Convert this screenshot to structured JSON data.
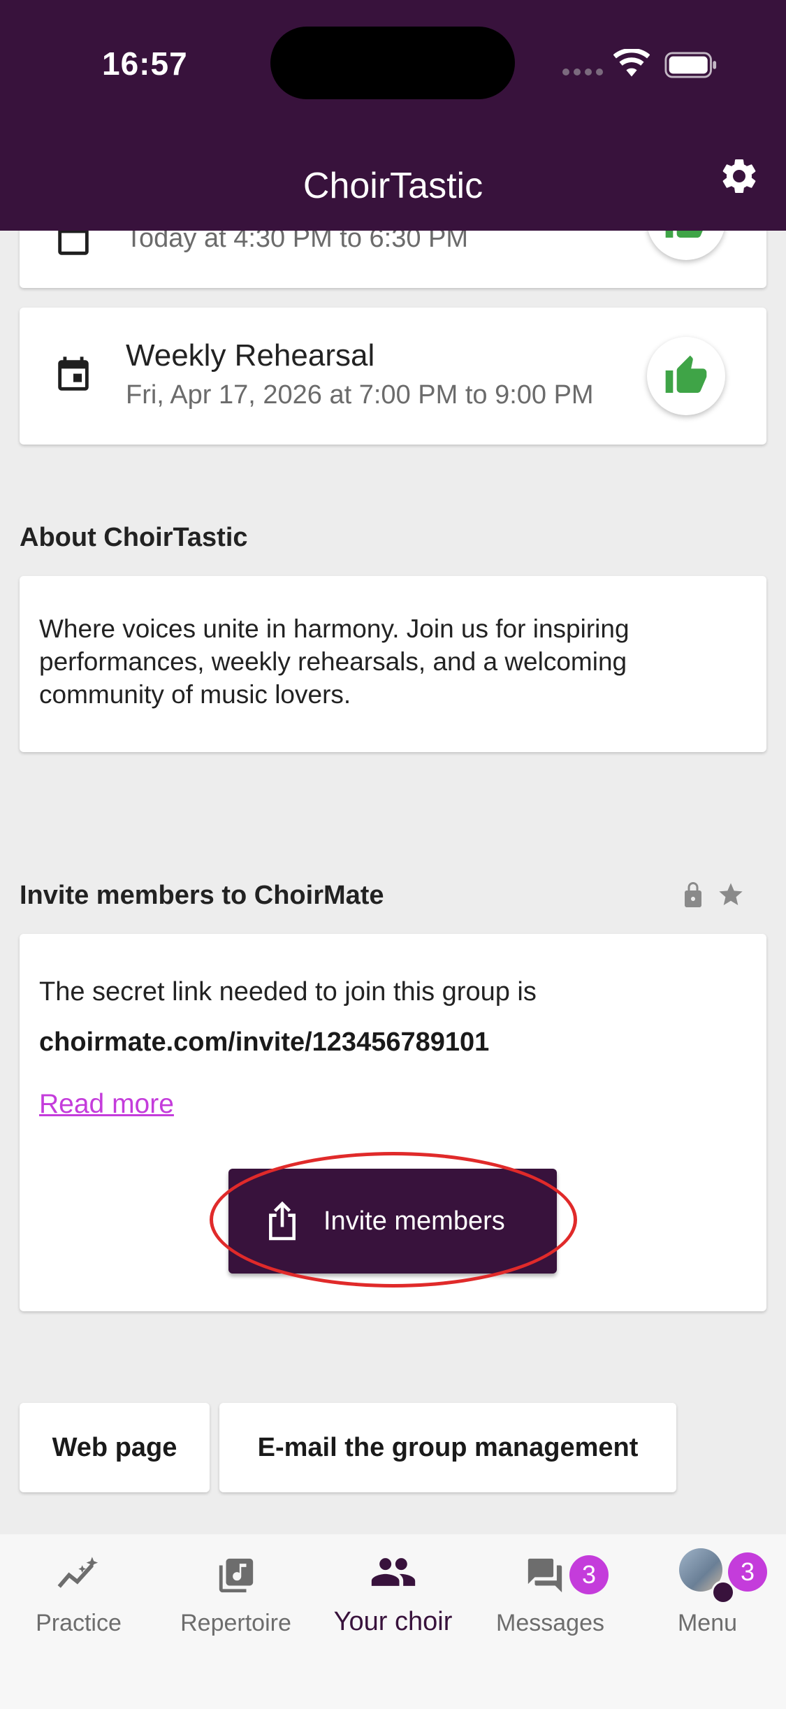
{
  "status_bar": {
    "time": "16:57"
  },
  "header": {
    "title": "ChoirTastic"
  },
  "events": [
    {
      "title": "",
      "subtitle": "Today at 4:30 PM to 6:30 PM"
    },
    {
      "title": "Weekly Rehearsal",
      "subtitle": "Fri, Apr 17, 2026 at 7:00 PM to 9:00 PM"
    }
  ],
  "about": {
    "heading": "About ChoirTastic",
    "text": "Where voices unite in harmony. Join us for inspiring performances, weekly rehearsals, and a welcoming community of music lovers."
  },
  "invite": {
    "heading": "Invite members to ChoirMate",
    "text": "The secret link needed to join this group is",
    "link": "choirmate.com/invite/123456789101",
    "read_more": "Read more",
    "button_label": "Invite members"
  },
  "buttons": {
    "web_page": "Web page",
    "email": "E-mail the group management"
  },
  "nav": {
    "items": [
      {
        "label": "Practice"
      },
      {
        "label": "Repertoire"
      },
      {
        "label": "Your choir"
      },
      {
        "label": "Messages",
        "badge": "3"
      },
      {
        "label": "Menu",
        "badge": "3"
      }
    ]
  },
  "colors": {
    "primary": "#38123c",
    "accent": "#c43cdb",
    "like": "#3fa447",
    "annotation": "#e02a2a"
  },
  "icons": [
    "calendar-icon",
    "thumbs-up-icon",
    "gear-icon",
    "lock-icon",
    "star-icon",
    "share-icon",
    "practice-icon",
    "repertoire-icon",
    "group-icon",
    "messages-icon",
    "avatar"
  ]
}
